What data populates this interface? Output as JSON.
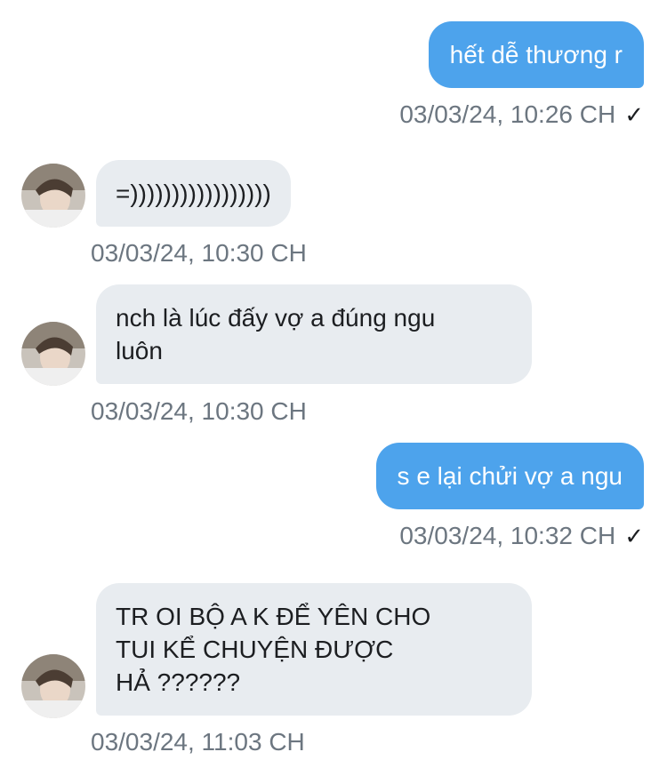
{
  "messages": [
    {
      "text": "hết dễ thương r",
      "time": "03/03/24, 10:26 CH",
      "status": "✓"
    },
    {
      "text": "=)))))))))))))))))",
      "time": "03/03/24, 10:30 CH"
    },
    {
      "text": "nch là lúc đấy vợ a đúng ngu\nluôn",
      "time": "03/03/24, 10:30 CH"
    },
    {
      "text": "s e lại chửi vợ a ngu",
      "time": "03/03/24, 10:32 CH",
      "status": "✓"
    },
    {
      "text": "TR OI BỘ A K ĐỂ YÊN CHO\nTUI KỂ CHUYỆN ĐƯỢC\nHẢ ??????",
      "time": "03/03/24, 11:03 CH"
    }
  ],
  "colors": {
    "outgoing_bubble": "#4da3ec",
    "incoming_bubble": "#e8ecf0",
    "timestamp": "#6c7680"
  }
}
